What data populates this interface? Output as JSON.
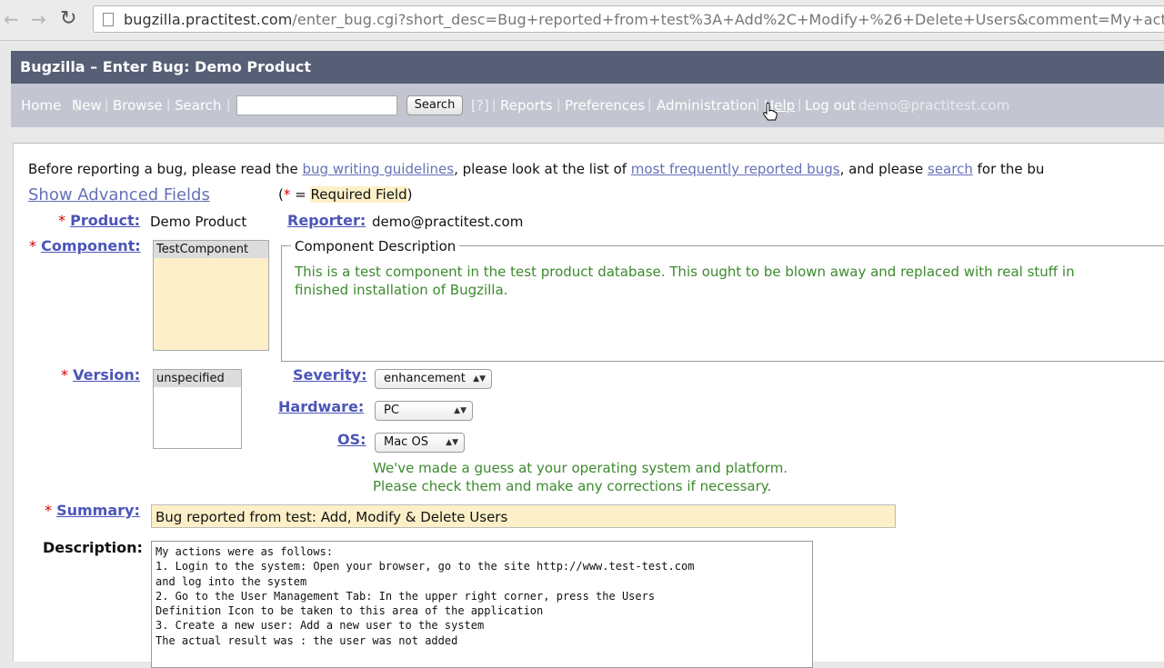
{
  "browser": {
    "back_icon": "back-arrow-icon",
    "forward_icon": "forward-arrow-icon",
    "reload_icon": "reload-icon",
    "url_host": "bugzilla.practitest.com",
    "url_path": "/enter_bug.cgi?short_desc=Bug+reported+from+test%3A+Add%2C+Modify+%26+Delete+Users&comment=My+actions+"
  },
  "header": {
    "title": "Bugzilla – Enter Bug: Demo Product"
  },
  "nav": {
    "items": [
      "Home",
      "New",
      "Browse",
      "Search"
    ],
    "search_button": "Search",
    "help_q": "[?]",
    "items2": [
      "Reports",
      "Preferences",
      "Administration",
      "Help",
      "Log out"
    ],
    "user": "demo@practitest.com"
  },
  "intro": {
    "t1": "Before reporting a bug, please read the ",
    "l1": "bug writing guidelines",
    "t2": ", please look at the list of ",
    "l2": "most frequently reported bugs",
    "t3": ", and please ",
    "l3": "search",
    "t4": " for the bu"
  },
  "advanced_link": "Show Advanced Fields",
  "required_note": {
    "open": "(",
    "star": "*",
    "eq": " = ",
    "text": "Required Field",
    "close": ")"
  },
  "form": {
    "product_label": "Product:",
    "product_value": "Demo Product",
    "reporter_label": "Reporter:",
    "reporter_value": "demo@practitest.com",
    "component_label": "Component:",
    "component_option": "TestComponent",
    "component_desc_legend": "Component Description",
    "component_desc_l1": "This is a test component in the test product database. This ought to be blown away and replaced with real stuff in",
    "component_desc_l2": "finished installation of Bugzilla.",
    "version_label": "Version:",
    "version_option": "unspecified",
    "severity_label": "Severity:",
    "severity_value": "enhancement",
    "hardware_label": "Hardware:",
    "hardware_value": "PC",
    "os_label": "OS:",
    "os_value": "Mac OS",
    "guess_l1": "We've made a guess at your operating system and platform.",
    "guess_l2": "Please check them and make any corrections if necessary.",
    "summary_label": "Summary:",
    "summary_value": "Bug reported from test: Add, Modify & Delete Users",
    "description_label": "Description:",
    "description_value": "My actions were as follows:\n1. Login to the system: Open your browser, go to the site http://www.test-test.com\nand log into the system\n2. Go to the User Management Tab: In the upper right corner, press the Users\nDefinition Icon to be taken to this area of the application\n3. Create a new user: Add a new user to the system\nThe actual result was : the user was not added"
  }
}
